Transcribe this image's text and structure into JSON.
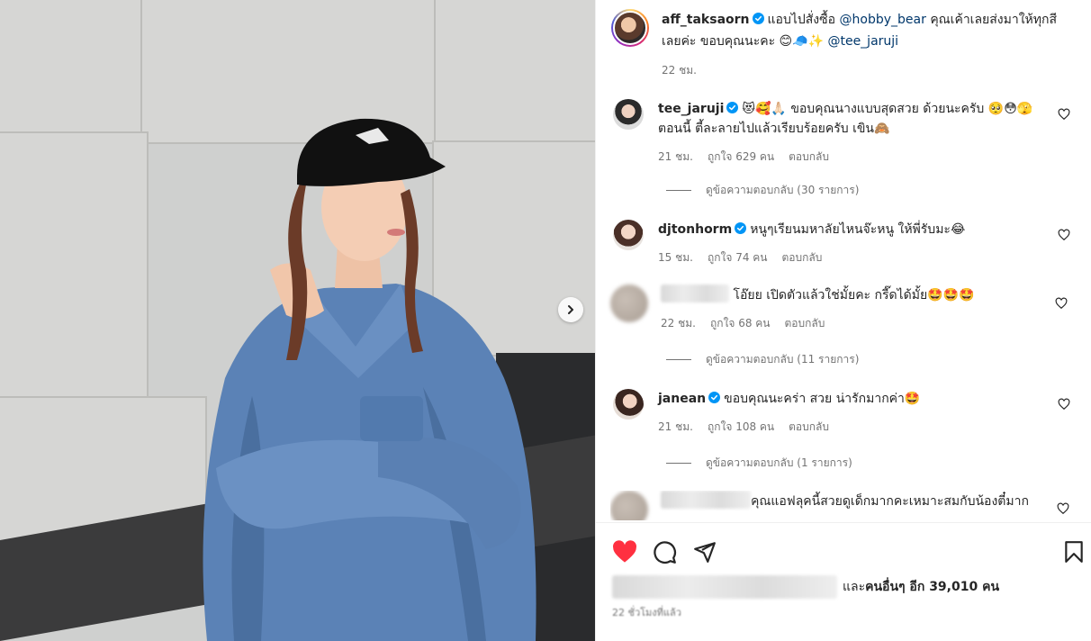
{
  "post": {
    "author": "aff_taksaorn",
    "caption_text": "แอบไปสั่งซื้อ",
    "caption_mention1": "@hobby_bear",
    "caption_text2": "คุณเค้าเลยส่งมาให้ทุกสีเลยค่ะ ขอบคุณนะคะ 😊🧢✨",
    "caption_mention2": "@tee_jaruji",
    "time": "22 ชม."
  },
  "comments": [
    {
      "username": "tee_jaruji",
      "verified": true,
      "text": "😻🥰🙏🏻 ขอบคุณนางแบบสุดสวย ด้วยนะครับ 🥺😳🫣 ตอนนี้ ตี้ละลายไปแล้วเรียบร้อยครับ เขิน🙈",
      "time": "21 ชม.",
      "likes": "ถูกใจ 629 คน",
      "reply": "ตอบกลับ",
      "view_replies": "ดูข้อความตอบกลับ (30 รายการ)"
    },
    {
      "username": "djtonhorm",
      "verified": true,
      "text": "หนูๆเรียนมหาลัยไหนจ๊ะหนู ให้พี่รับมะ😂",
      "time": "15 ชม.",
      "likes": "ถูกใจ 74 คน",
      "reply": "ตอบกลับ"
    },
    {
      "username": "",
      "verified": false,
      "text": "โอ๊ยย เปิดตัวแล้วใช่มั้ยคะ กรี๊ดได้มั้ย🤩🤩🤩",
      "time": "22 ชม.",
      "likes": "ถูกใจ 68 คน",
      "reply": "ตอบกลับ",
      "view_replies": "ดูข้อความตอบกลับ (11 รายการ)"
    },
    {
      "username": "janean",
      "verified": true,
      "text": "ขอบคุณนะคร่า สวย น่ารักมากค่า🤩",
      "time": "21 ชม.",
      "likes": "ถูกใจ 108 คน",
      "reply": "ตอบกลับ",
      "view_replies": "ดูข้อความตอบกลับ (1 รายการ)"
    },
    {
      "username": "",
      "verified": false,
      "text": "คุณแอฟลุคนี้สวยดูเด็กมากคะเหมาะสมกับน้องตี๋มาก"
    }
  ],
  "likes_summary": {
    "prefix": "และ",
    "others": "คนอื่นๆ อีก 39,010 คน"
  },
  "icons": {
    "like": "heart-filled-icon",
    "comment": "comment-icon",
    "share": "share-icon",
    "save": "bookmark-icon",
    "next": "chevron-right-icon",
    "verified": "verified-badge-icon"
  },
  "colors": {
    "like_red": "#ff3040",
    "verified_blue": "#0095f6",
    "mention": "#00376b",
    "secondary_text": "#737373"
  }
}
